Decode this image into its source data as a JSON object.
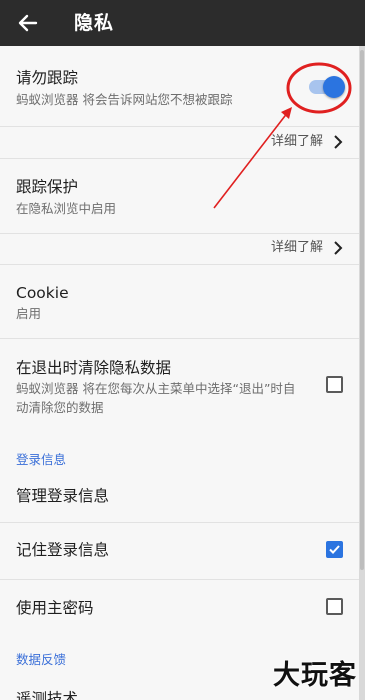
{
  "appbar": {
    "title": "隐私",
    "back_icon": "arrow-left-icon"
  },
  "dnt": {
    "title": "请勿跟踪",
    "subtitle": "蚂蚁浏览器 将会告诉网站您不想被跟踪",
    "enabled": true
  },
  "dnt_more": {
    "label": "详细了解"
  },
  "tracking": {
    "title": "跟踪保护",
    "subtitle": "在隐私浏览中启用"
  },
  "tracking_more": {
    "label": "详细了解"
  },
  "cookie": {
    "title": "Cookie",
    "subtitle": "启用"
  },
  "clear": {
    "title": "在退出时清除隐私数据",
    "subtitle": "蚂蚁浏览器 将在您每次从主菜单中选择“退出”时自动清除您的数据",
    "checked": false
  },
  "login_section": {
    "header": "登录信息"
  },
  "manage_logins": {
    "title": "管理登录信息"
  },
  "remember_logins": {
    "title": "记住登录信息",
    "checked": true
  },
  "master_password": {
    "title": "使用主密码",
    "checked": false
  },
  "feedback_section": {
    "header": "数据反馈"
  },
  "telemetry": {
    "title": "遥测技术"
  },
  "watermark": {
    "text": "大玩客"
  },
  "colors": {
    "accent": "#2b74e0",
    "annotation": "#e02020",
    "appbar": "#2c2c2c"
  }
}
